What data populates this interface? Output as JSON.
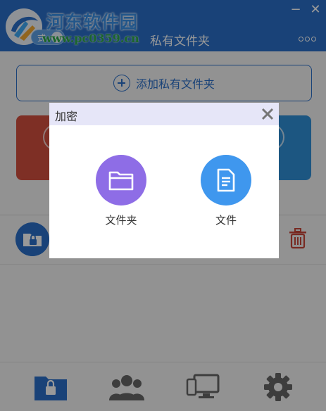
{
  "watermark": {
    "title": "河东软件园",
    "url": "www.pc0359.cn"
  },
  "titlebar": {
    "mode_label": "式",
    "app_title": "私有文件夹",
    "minimize_glyph": "−",
    "close_glyph": "✕"
  },
  "main": {
    "add_folder_label": "添加私有文件夹"
  },
  "dialog": {
    "title": "加密",
    "options": [
      {
        "label": "文件夹",
        "icon": "folder-icon",
        "color": "#8e6de6"
      },
      {
        "label": "文件",
        "icon": "document-icon",
        "color": "#3f97ee"
      }
    ]
  },
  "bottom_nav": {
    "items": [
      {
        "icon": "lock-folder-icon"
      },
      {
        "icon": "users-icon"
      },
      {
        "icon": "devices-icon"
      },
      {
        "icon": "gear-icon"
      }
    ]
  },
  "colors": {
    "titlebar": "#2a6fc9",
    "accent": "#2a6fc9",
    "card_red": "#d24f3f",
    "card_blue": "#2f8fd8",
    "trash": "#c8473a"
  }
}
